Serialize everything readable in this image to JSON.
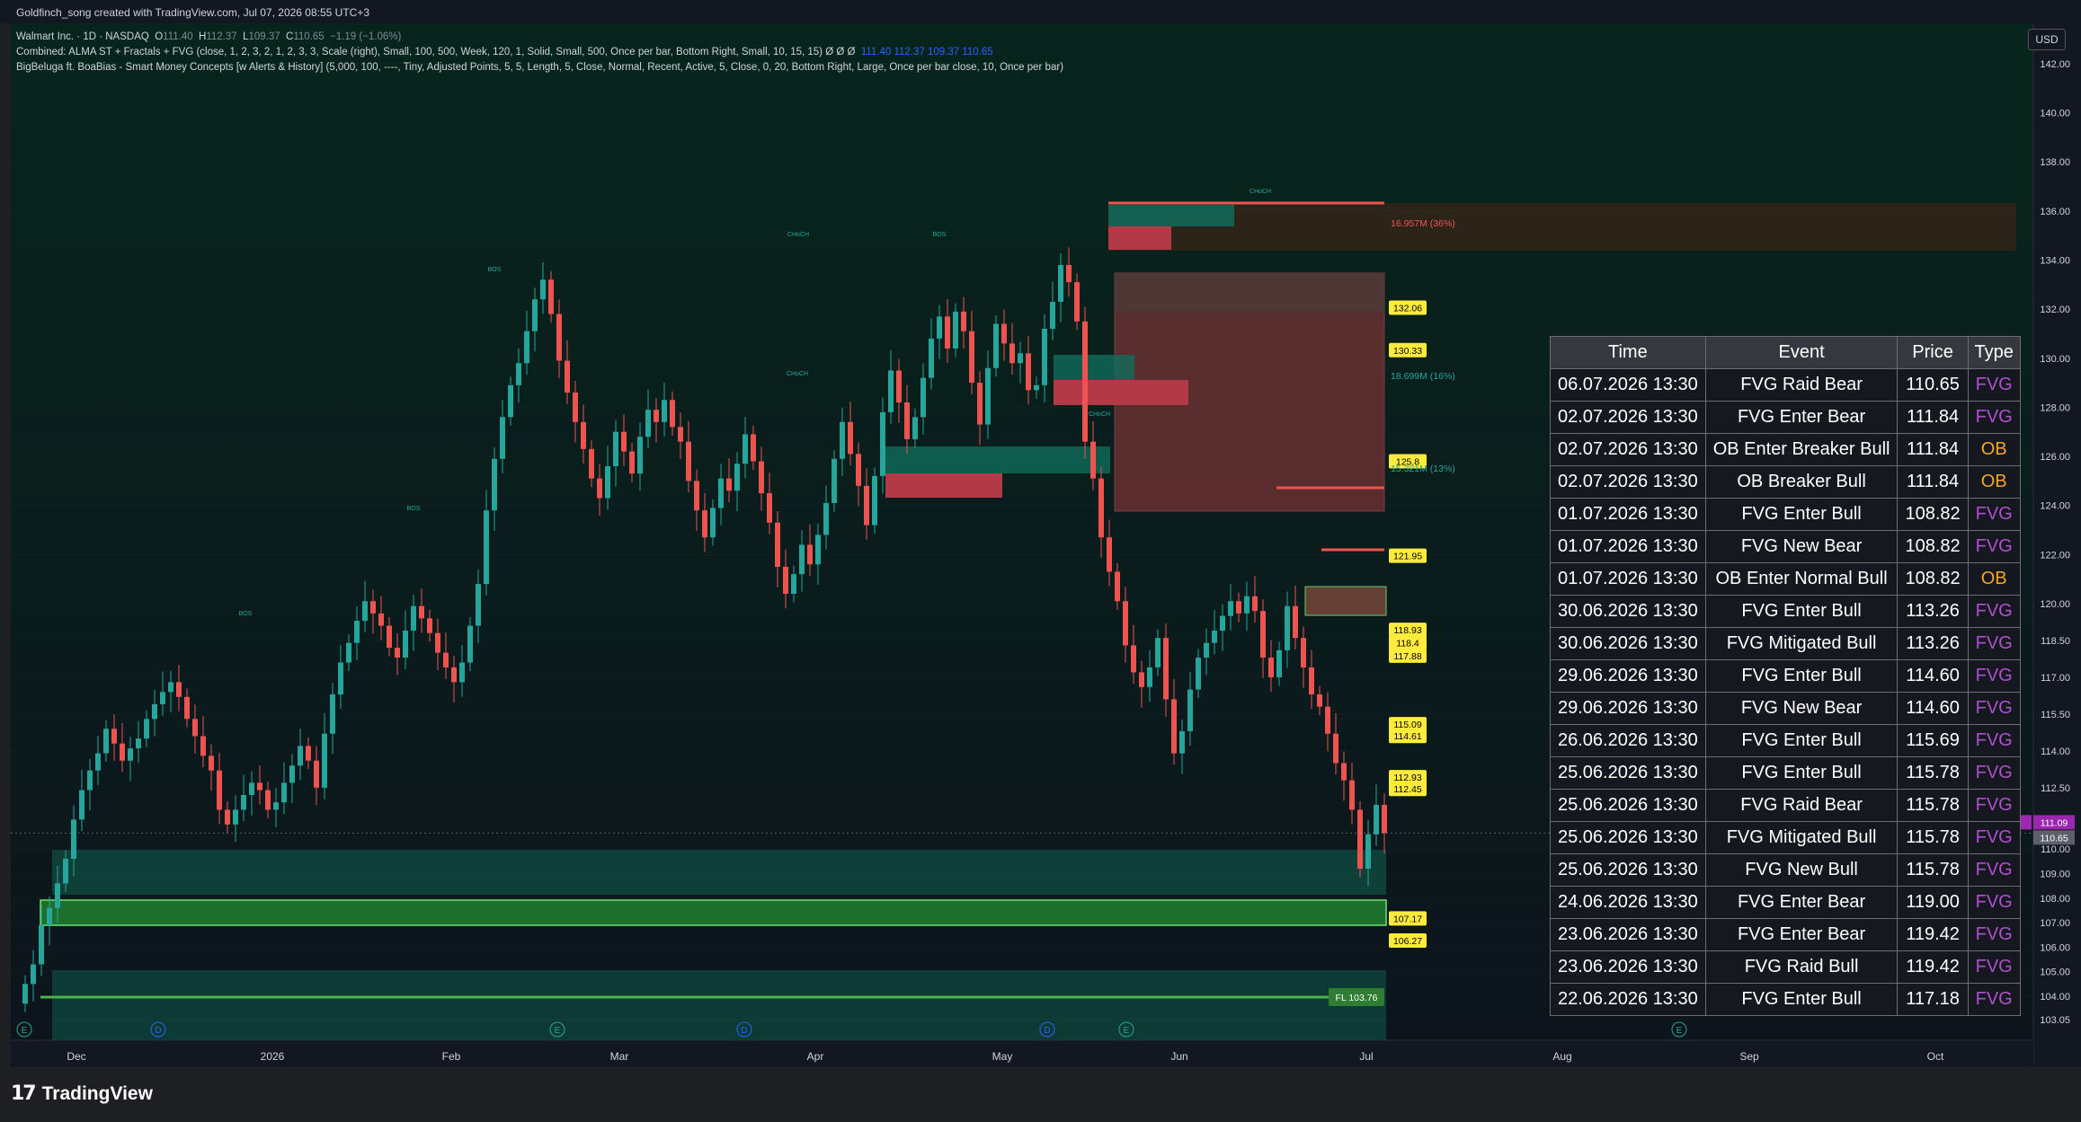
{
  "header": {
    "caption": "Goldfinch_song created with TradingView.com, Jul 07, 2026 08:55 UTC+3",
    "symbol_line": {
      "name": "Walmart Inc. · 1D · NASDAQ",
      "o_label": "O",
      "o": "111.40",
      "h_label": "H",
      "h": "112.37",
      "l_label": "L",
      "l": "109.37",
      "c_label": "C",
      "c": "110.65",
      "change": "−1.19 (−1.06%)"
    },
    "indicator1": {
      "text": "Combined: ALMA ST + Fractals + FVG (close, 1, 2, 3, 2, 1, 2, 3, 3, Scale (right), Small, 100, 500, Week, 120, 1, Solid, Small, 500, Once per bar, Bottom Right, Small, 10, 15, 15)  Ø  Ø  Ø",
      "values": "111.40   112.37   109.37   110.65"
    },
    "indicator2": "BigBeluga ft. BoaBias - Smart Money Concepts [w Alerts & History] (5,000, 100, ----, Tiny, Adjusted Points, 5, 5, Length, 5, Close, Normal, Recent, Active, 5, Close, 0, 20, Bottom Right, Large, Once per bar close, 10, Once per bar)"
  },
  "currency": "USD",
  "brand": {
    "logo": "17",
    "name": "TradingView"
  },
  "colors": {
    "bull": "#26a69a",
    "bear": "#ef5350",
    "background_top": "#07251c",
    "background_bottom": "#0d141c",
    "label_yellow": "#ffeb3b",
    "fvg_purple": "#b04fd0",
    "ob_orange": "#f4a629",
    "overnight": "#9c27b0"
  },
  "table": {
    "headers": [
      "Time",
      "Event",
      "Price",
      "Type"
    ],
    "rows": [
      [
        "06.07.2026 13:30",
        "FVG Raid Bear",
        "110.65",
        "FVG"
      ],
      [
        "02.07.2026 13:30",
        "FVG Enter Bear",
        "111.84",
        "FVG"
      ],
      [
        "02.07.2026 13:30",
        "OB Enter Breaker Bull",
        "111.84",
        "OB"
      ],
      [
        "02.07.2026 13:30",
        "OB Breaker Bull",
        "111.84",
        "OB"
      ],
      [
        "01.07.2026 13:30",
        "FVG Enter Bull",
        "108.82",
        "FVG"
      ],
      [
        "01.07.2026 13:30",
        "FVG New Bear",
        "108.82",
        "FVG"
      ],
      [
        "01.07.2026 13:30",
        "OB Enter Normal Bull",
        "108.82",
        "OB"
      ],
      [
        "30.06.2026 13:30",
        "FVG Enter Bull",
        "113.26",
        "FVG"
      ],
      [
        "30.06.2026 13:30",
        "FVG Mitigated Bull",
        "113.26",
        "FVG"
      ],
      [
        "29.06.2026 13:30",
        "FVG Enter Bull",
        "114.60",
        "FVG"
      ],
      [
        "29.06.2026 13:30",
        "FVG New Bear",
        "114.60",
        "FVG"
      ],
      [
        "26.06.2026 13:30",
        "FVG Enter Bull",
        "115.69",
        "FVG"
      ],
      [
        "25.06.2026 13:30",
        "FVG Enter Bull",
        "115.78",
        "FVG"
      ],
      [
        "25.06.2026 13:30",
        "FVG Raid Bear",
        "115.78",
        "FVG"
      ],
      [
        "25.06.2026 13:30",
        "FVG Mitigated Bull",
        "115.78",
        "FVG"
      ],
      [
        "25.06.2026 13:30",
        "FVG New Bull",
        "115.78",
        "FVG"
      ],
      [
        "24.06.2026 13:30",
        "FVG Enter Bear",
        "119.00",
        "FVG"
      ],
      [
        "23.06.2026 13:30",
        "FVG Enter Bear",
        "119.42",
        "FVG"
      ],
      [
        "23.06.2026 13:30",
        "FVG Raid Bull",
        "119.42",
        "FVG"
      ],
      [
        "22.06.2026 13:30",
        "FVG Enter Bull",
        "117.18",
        "FVG"
      ]
    ]
  },
  "chart_data": {
    "type": "candlestick",
    "symbol": "Walmart Inc.",
    "interval": "1D",
    "exchange": "NASDAQ",
    "ylim": [
      102.5,
      143.5
    ],
    "y_ticks": [
      "142.00",
      "140.00",
      "138.00",
      "136.00",
      "134.00",
      "132.00",
      "130.00",
      "128.00",
      "126.00",
      "124.00",
      "122.00",
      "120.00",
      "118.50",
      "117.00",
      "115.50",
      "114.00",
      "112.50",
      "110.00",
      "109.00",
      "108.00",
      "107.00",
      "106.00",
      "105.00",
      "104.00",
      "103.05"
    ],
    "x_ticks": [
      "Dec",
      "2026",
      "Feb",
      "Mar",
      "Apr",
      "May",
      "Jun",
      "Jul",
      "Aug",
      "Sep",
      "Oct"
    ],
    "events_markers": [
      "E",
      "D",
      "E",
      "D",
      "D",
      "E",
      "E"
    ],
    "last_price": "110.65",
    "overnight_label": "Overnight",
    "overnight_price": "111.09",
    "price_labels": [
      "132.06",
      "130.33",
      "125.8",
      "121.95",
      "118.93",
      "118.4",
      "117.88",
      "115.09",
      "114.61",
      "112.93",
      "112.45",
      "107.17",
      "106.27"
    ],
    "fractal_low_label": "FL 103.76",
    "volume_labels": [
      "16.957M (36%)",
      "18.699M (16%)",
      "15.321M (13%)"
    ],
    "structure_labels": [
      "BOS",
      "BOS",
      "BOS",
      "BOS",
      "CHoCH",
      "CHoCH",
      "CHoCH",
      "CHoCH"
    ],
    "closes": [
      104.5,
      105.3,
      106.9,
      107.6,
      108.6,
      109.6,
      111.2,
      112.4,
      113.2,
      113.9,
      114.9,
      114.3,
      113.6,
      114.1,
      114.5,
      115.3,
      115.9,
      116.4,
      116.8,
      116.2,
      115.3,
      114.6,
      113.8,
      113.2,
      111.6,
      111.0,
      111.6,
      112.2,
      112.7,
      112.4,
      111.6,
      111.9,
      112.7,
      113.4,
      114.2,
      113.6,
      112.5,
      114.7,
      116.3,
      117.6,
      118.4,
      119.3,
      120.1,
      119.6,
      119.1,
      118.2,
      117.8,
      118.9,
      119.9,
      119.4,
      118.8,
      118.0,
      117.4,
      116.8,
      117.6,
      119.1,
      120.8,
      123.8,
      125.9,
      127.6,
      128.9,
      129.8,
      131.1,
      132.4,
      133.2,
      131.8,
      129.9,
      128.6,
      127.4,
      126.3,
      125.1,
      124.3,
      125.6,
      127.0,
      126.2,
      125.3,
      126.8,
      127.9,
      127.4,
      128.3,
      127.2,
      126.6,
      125.0,
      123.8,
      122.7,
      123.9,
      125.1,
      124.6,
      125.7,
      126.9,
      125.8,
      124.5,
      123.3,
      121.5,
      120.4,
      121.2,
      122.4,
      121.6,
      122.8,
      124.1,
      125.9,
      127.4,
      126.1,
      124.8,
      123.2,
      125.2,
      127.8,
      129.5,
      128.2,
      126.7,
      127.6,
      129.2,
      130.8,
      131.7,
      130.4,
      131.9,
      131.1,
      129.0,
      127.3,
      129.6,
      131.4,
      130.6,
      129.8,
      130.2,
      128.7,
      128.9,
      131.2,
      132.3,
      133.8,
      133.1,
      131.5,
      126.6,
      125.1,
      122.7,
      121.3,
      120.1,
      118.3,
      117.2,
      116.6,
      117.4,
      118.6,
      116.1,
      113.9,
      114.8,
      116.5,
      117.8,
      118.4,
      118.9,
      119.5,
      120.1,
      119.6,
      120.3,
      119.7,
      117.8,
      117.0,
      118.1,
      119.9,
      118.6,
      117.4,
      116.3,
      115.8,
      114.7,
      113.5,
      112.8,
      111.6,
      109.2,
      110.6,
      111.8,
      110.65
    ]
  }
}
